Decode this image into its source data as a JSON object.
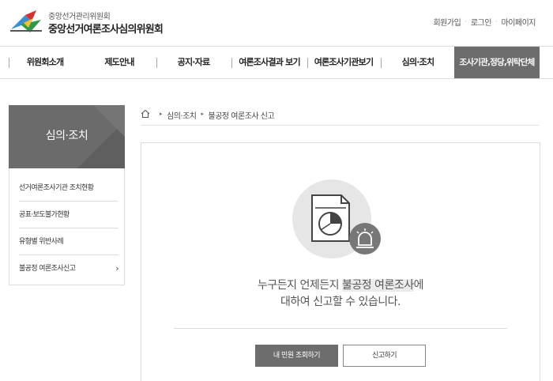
{
  "header": {
    "org_sub": "중앙선거관리위원회",
    "org_main": "중앙선거여론조사심의위원회",
    "util_links": [
      "회원가입",
      "로그인",
      "마이페이지"
    ],
    "util_separator": "·"
  },
  "gnb": {
    "items": [
      {
        "label": "위원회소개"
      },
      {
        "label": "제도안내"
      },
      {
        "label": "공지·자료"
      },
      {
        "label": "여론조사결과 보기"
      },
      {
        "label": "여론조사기관보기"
      },
      {
        "label": "심의·조치"
      },
      {
        "label": "조사기관,정당,위탁단체"
      }
    ]
  },
  "sidebar": {
    "title": "심의·조치",
    "items": [
      {
        "label": "선거여론조사기관 조치현황"
      },
      {
        "label": "공표·보도불가현황"
      },
      {
        "label": "유형별 위반사례"
      },
      {
        "label": "불공정 여론조사신고",
        "chevron": "›"
      }
    ]
  },
  "breadcrumb": {
    "items": [
      "심의·조치",
      "불공정 여론조사 신고"
    ],
    "separator": "▸"
  },
  "content": {
    "illustration_icon": "report-document-chart-icon",
    "alarm_icon": "siren-icon",
    "message_prefix": "누구든지 언제든지 ",
    "message_highlight": "불공정 여론조사",
    "message_suffix": "에",
    "message_line2": "대하여 신고할 수 있습니다.",
    "button_primary": "내 민원 조회하기",
    "button_secondary": "신고하기"
  },
  "colors": {
    "active_nav_bg": "#6d6d6d",
    "sidebar_title_bg": "#6b6b6b",
    "primary_button_bg": "#6d6d6d",
    "illustration_circle": "#e6e6e6",
    "alarm_circle": "#777777"
  }
}
